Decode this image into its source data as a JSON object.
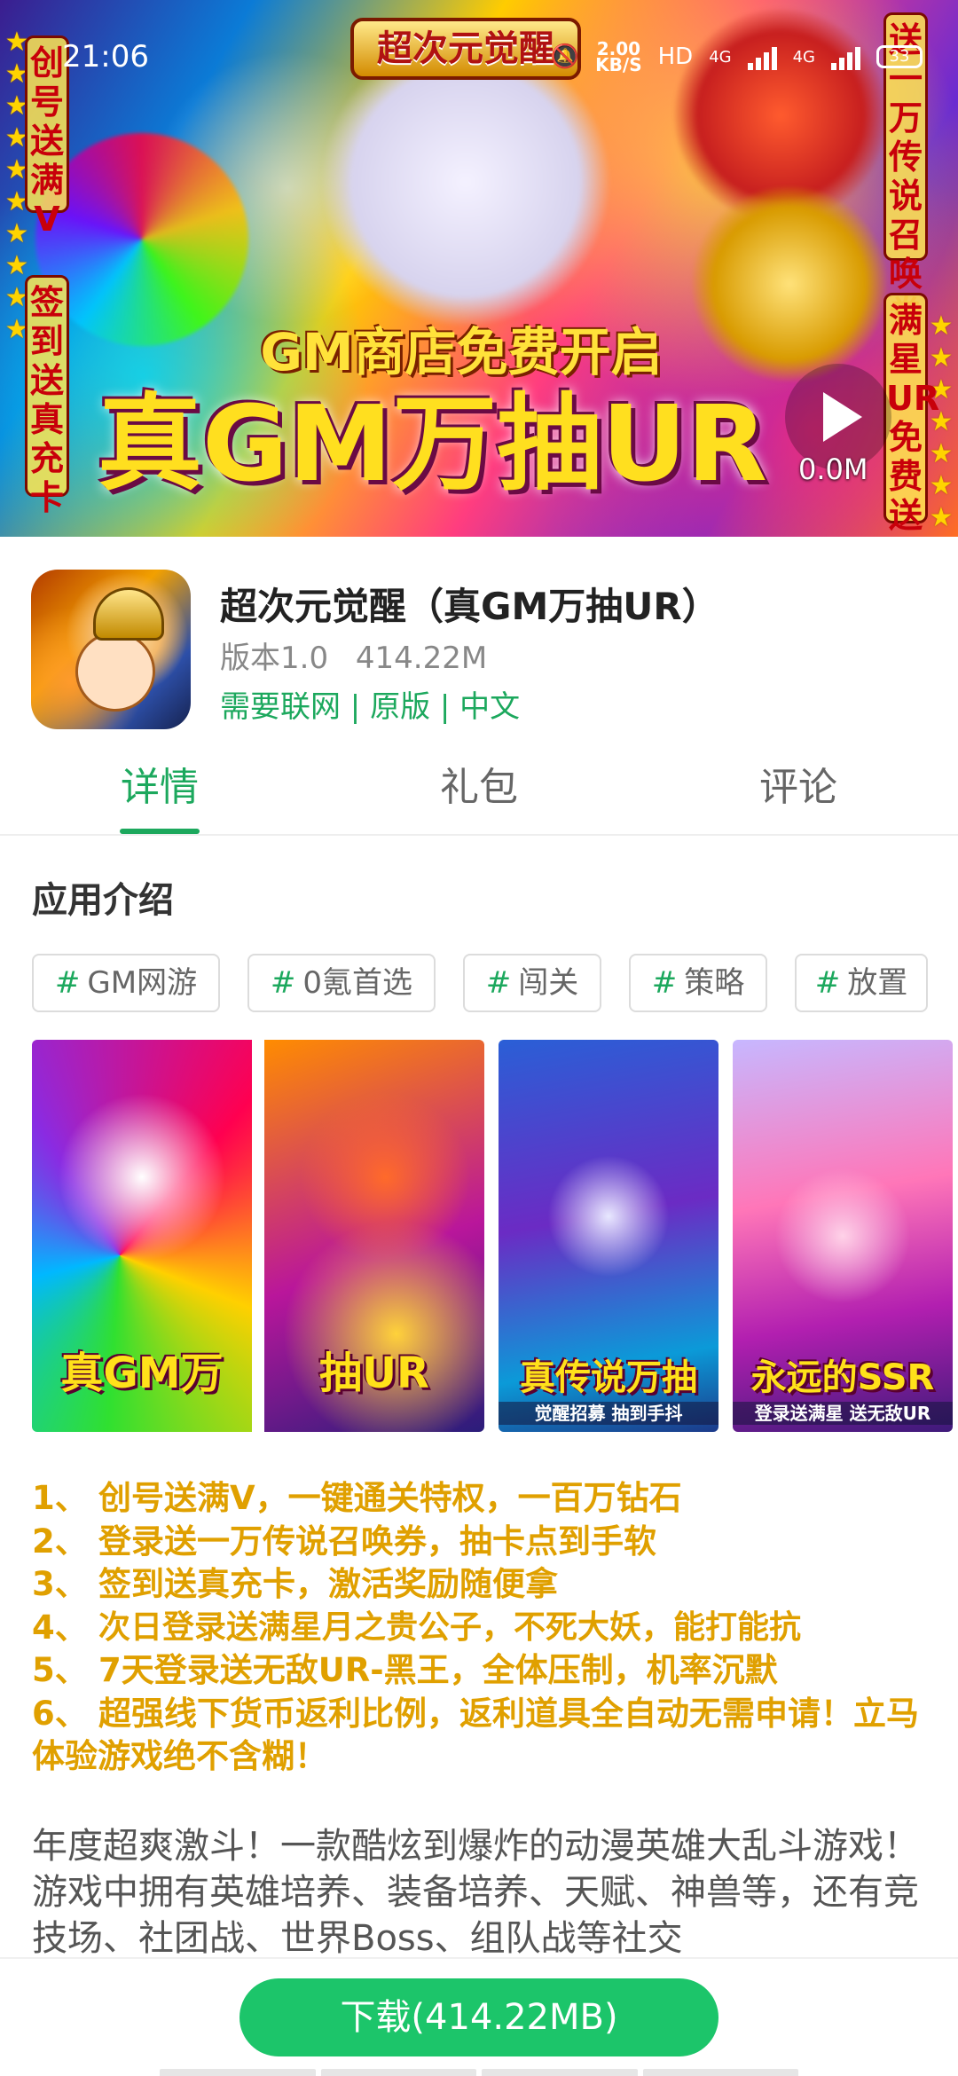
{
  "status_bar": {
    "time": "21:06",
    "net_speed": "2.00",
    "net_unit": "KB/S",
    "hd": "HD",
    "net_type_1": "4G",
    "net_type_2": "4G",
    "battery": "33"
  },
  "banner": {
    "logo_text": "超次元觉醒",
    "headline_sub": "GM商店免费开启",
    "headline_main": "真GM万抽UR",
    "left_top": "创号送满V",
    "left_bottom": "签到送真充卡",
    "right_top": "送一万传说召唤券",
    "right_bottom": "满星UR免费送",
    "video_size": "0.0M"
  },
  "app": {
    "name": "超次元觉醒（真GM万抽UR）",
    "version": "版本1.0",
    "size": "414.22M",
    "tags_line": "需要联网 | 原版 | 中文"
  },
  "tabs": [
    {
      "label": "详情",
      "active": true
    },
    {
      "label": "礼包",
      "active": false
    },
    {
      "label": "评论",
      "active": false
    }
  ],
  "intro": {
    "title": "应用介绍",
    "hash": "#",
    "tags": [
      "GM网游",
      "0氪首选",
      "闯关",
      "策略",
      "放置"
    ]
  },
  "screenshots": [
    {
      "caption": "真GM万",
      "sub": ""
    },
    {
      "caption": "抽UR",
      "sub": ""
    },
    {
      "caption": "真传说万抽",
      "sub": "觉醒招募 抽到手抖"
    },
    {
      "caption": "永远的SSR",
      "sub": "登录送满星 送无敌UR"
    }
  ],
  "features": [
    {
      "num": "1、",
      "text": "创号送满V，一键通关特权，一百万钻石"
    },
    {
      "num": "2、",
      "text": "登录送一万传说召唤券，抽卡点到手软"
    },
    {
      "num": "3、",
      "text": "签到送真充卡，激活奖励随便拿"
    },
    {
      "num": "4、",
      "text": "次日登录送满星月之贵公子，不死大妖，能打能抗"
    },
    {
      "num": "5、",
      "text": "7天登录送无敌UR-黑王，全体压制，机率沉默"
    },
    {
      "num": "6、",
      "text": "超强线下货币返利比例，返利道具全自动无需申请！立马体验游戏绝不含糊！"
    }
  ],
  "description": "年度超爽激斗！一款酷炫到爆炸的动漫英雄大乱斗游戏！游戏中拥有英雄培养、装备培养、天赋、神兽等，还有竞技场、社团战、世界Boss、组队战等社交",
  "download": {
    "label": "下载(414.22MB)"
  },
  "colors": {
    "accent": "#1ca85d",
    "download_button": "#1cc56a",
    "feature_text": "#e0a000"
  }
}
